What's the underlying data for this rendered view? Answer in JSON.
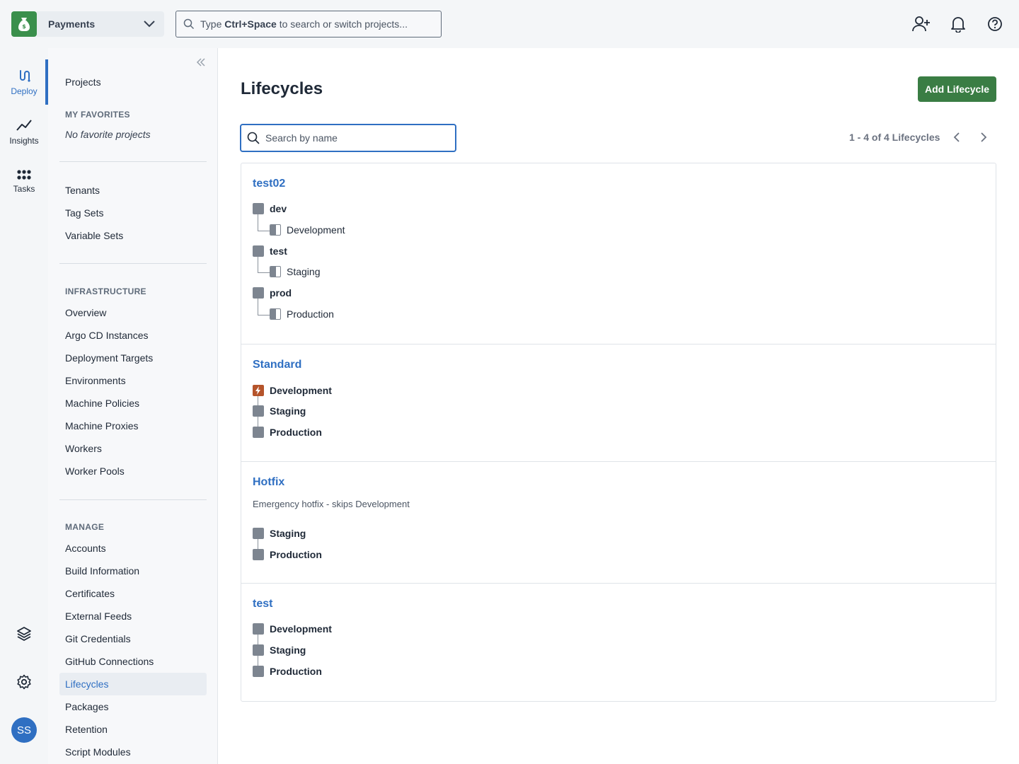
{
  "topbar": {
    "space_name": "Payments",
    "search_prefix": "Type",
    "search_shortcut": "Ctrl+Space",
    "search_suffix": "to search or switch projects..."
  },
  "rail": {
    "deploy": "Deploy",
    "insights": "Insights",
    "tasks": "Tasks",
    "avatar_initials": "SS"
  },
  "sidebar": {
    "projects": "Projects",
    "favorites_heading": "MY FAVORITES",
    "favorites_empty": "No favorite projects",
    "group1": [
      "Tenants",
      "Tag Sets",
      "Variable Sets"
    ],
    "infrastructure_heading": "INFRASTRUCTURE",
    "infrastructure": [
      "Overview",
      "Argo CD Instances",
      "Deployment Targets",
      "Environments",
      "Machine Policies",
      "Machine Proxies",
      "Workers",
      "Worker Pools"
    ],
    "manage_heading": "MANAGE",
    "manage": [
      "Accounts",
      "Build Information",
      "Certificates",
      "External Feeds",
      "Git Credentials",
      "GitHub Connections",
      "Lifecycles",
      "Packages",
      "Retention",
      "Script Modules"
    ]
  },
  "main": {
    "title": "Lifecycles",
    "add_button": "Add Lifecycle",
    "search_placeholder": "Search by name",
    "pager_text": "1 - 4 of 4 Lifecycles"
  },
  "lifecycles": [
    {
      "name": "test02",
      "phases": [
        {
          "name": "dev",
          "environments": [
            "Development"
          ]
        },
        {
          "name": "test",
          "environments": [
            "Staging"
          ]
        },
        {
          "name": "prod",
          "environments": [
            "Production"
          ]
        }
      ]
    },
    {
      "name": "Standard",
      "phases": [
        {
          "name": "Development",
          "icon": "lightning-icon"
        },
        {
          "name": "Staging"
        },
        {
          "name": "Production"
        }
      ]
    },
    {
      "name": "Hotfix",
      "description": "Emergency hotfix - skips Development",
      "phases": [
        {
          "name": "Staging"
        },
        {
          "name": "Production"
        }
      ]
    },
    {
      "name": "test",
      "phases": [
        {
          "name": "Development"
        },
        {
          "name": "Staging"
        },
        {
          "name": "Production"
        }
      ]
    }
  ],
  "colors": {
    "brand_green": "#3a7d44",
    "link_blue": "#2f6fc2",
    "phase_gray": "#7d8590",
    "automatic_phase": "#b5542b"
  }
}
